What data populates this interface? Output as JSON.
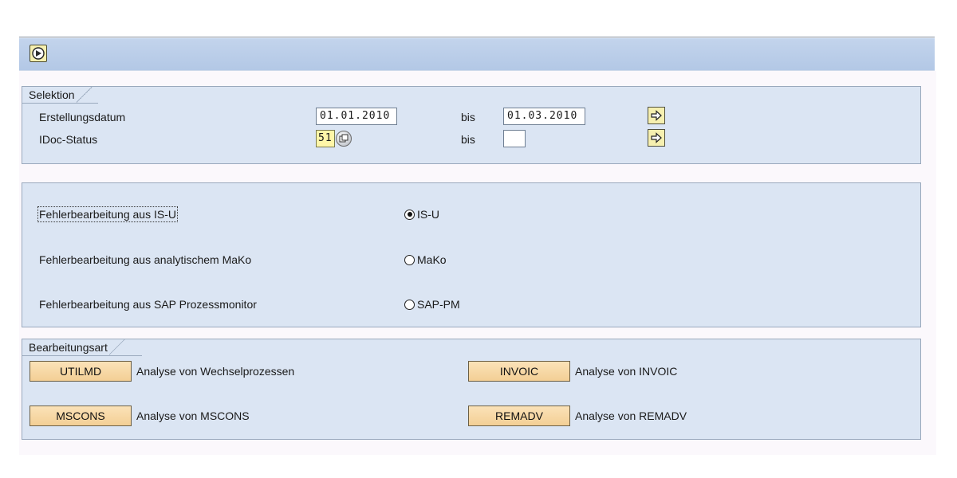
{
  "toolbar": {
    "execute_icon": "execute-clock-icon"
  },
  "selection": {
    "title": "Selektion",
    "rows": [
      {
        "label": "Erstellungsdatum",
        "from": "01.01.2010",
        "to_label": "bis",
        "to": "01.03.2010"
      },
      {
        "label": "IDoc-Status",
        "from": "51",
        "to_label": "bis",
        "to": ""
      }
    ]
  },
  "processing": {
    "options": [
      {
        "label": "Fehlerbearbeitung aus IS-U",
        "radio": "IS-U",
        "selected": true
      },
      {
        "label": "Fehlerbearbeitung aus analytischem MaKo",
        "radio": "MaKo",
        "selected": false
      },
      {
        "label": "Fehlerbearbeitung aus SAP Prozessmonitor",
        "radio": "SAP-PM",
        "selected": false
      }
    ]
  },
  "mode": {
    "title": "Bearbeitungsart",
    "buttons": [
      {
        "label": "UTILMD",
        "desc": "Analyse von Wechselprozessen"
      },
      {
        "label": "MSCONS",
        "desc": "Analyse von MSCONS"
      },
      {
        "label": "INVOIC",
        "desc": "Analyse von INVOIC"
      },
      {
        "label": "REMADV",
        "desc": "Analyse von REMADV"
      }
    ]
  },
  "colors": {
    "toolbar": "#b8cce8",
    "group_bg": "#dbe5f3",
    "button_bg": "#f6d7a3",
    "required_field": "#fff6a8"
  }
}
